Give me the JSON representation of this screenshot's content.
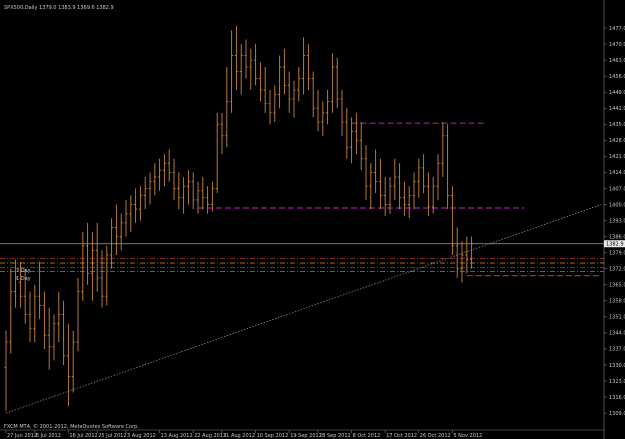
{
  "window": {
    "header": "SPX500,Daily  1379.0 1383.9 1369.6 1382.9",
    "watermark": "FXCM MT4, © 2001-2012, MetaQuotes Software Corp.",
    "current_price_tag": "1382.9",
    "level_labels": [
      "3 Day",
      "1 Day"
    ]
  },
  "colors": {
    "background": "#000000",
    "bars": "#c9863c",
    "resistance": "#a01aa0",
    "trendline": "#8b95c8",
    "price_line": "#a0a0a0",
    "pivot_a": "#c03030",
    "pivot_b": "#c8a800",
    "pivot_c": "#20a020",
    "pivot_d": "#30a0a0"
  },
  "chart_data": {
    "type": "ohlc",
    "symbol": "SPX500",
    "timeframe": "Daily",
    "ylim": [
      1306,
      1484
    ],
    "yticks": [
      1477.0,
      1470.0,
      1463.0,
      1456.0,
      1449.0,
      1442.0,
      1435.0,
      1428.0,
      1421.0,
      1414.0,
      1407.0,
      1400.0,
      1393.0,
      1386.0,
      1379.0,
      1372.0,
      1365.0,
      1358.0,
      1351.0,
      1344.0,
      1337.0,
      1330.0,
      1323.0,
      1316.0,
      1309.0
    ],
    "xticks": [
      "27 Jun 2012",
      "6 Jul 2012",
      "16 Jul 2012",
      "25 Jul 2012",
      "3 Aug 2012",
      "13 Aug 2012",
      "22 Aug 2012",
      "31 Aug 2012",
      "10 Sep 2012",
      "19 Sep 2012",
      "28 Sep 2012",
      "8 Oct 2012",
      "17 Oct 2012",
      "26 Oct 2012",
      "5 Nov 2012"
    ],
    "xtick_index": [
      0,
      6,
      13,
      19,
      25,
      32,
      39,
      45,
      52,
      59,
      65,
      72,
      79,
      86,
      93
    ],
    "last_price": 1382.9,
    "bars": [
      [
        1329,
        1345,
        1310,
        1340
      ],
      [
        1340,
        1372,
        1335,
        1362
      ],
      [
        1362,
        1376,
        1355,
        1368
      ],
      [
        1366,
        1375,
        1355,
        1360
      ],
      [
        1360,
        1372,
        1348,
        1352
      ],
      [
        1352,
        1362,
        1340,
        1346
      ],
      [
        1346,
        1365,
        1340,
        1360
      ],
      [
        1360,
        1375,
        1350,
        1356
      ],
      [
        1356,
        1362,
        1337,
        1343
      ],
      [
        1343,
        1355,
        1328,
        1338
      ],
      [
        1338,
        1352,
        1332,
        1348
      ],
      [
        1348,
        1362,
        1340,
        1352
      ],
      [
        1352,
        1358,
        1330,
        1334
      ],
      [
        1334,
        1348,
        1312,
        1325
      ],
      [
        1325,
        1345,
        1318,
        1340
      ],
      [
        1340,
        1368,
        1336,
        1362
      ],
      [
        1362,
        1388,
        1358,
        1382
      ],
      [
        1382,
        1392,
        1365,
        1370
      ],
      [
        1370,
        1388,
        1358,
        1380
      ],
      [
        1380,
        1392,
        1362,
        1368
      ],
      [
        1368,
        1380,
        1355,
        1360
      ],
      [
        1360,
        1382,
        1356,
        1378
      ],
      [
        1378,
        1394,
        1372,
        1390
      ],
      [
        1390,
        1400,
        1378,
        1386
      ],
      [
        1386,
        1396,
        1380,
        1392
      ],
      [
        1392,
        1402,
        1386,
        1396
      ],
      [
        1396,
        1404,
        1388,
        1400
      ],
      [
        1400,
        1407,
        1392,
        1398
      ],
      [
        1398,
        1408,
        1393,
        1404
      ],
      [
        1404,
        1412,
        1398,
        1407
      ],
      [
        1407,
        1414,
        1400,
        1410
      ],
      [
        1410,
        1418,
        1404,
        1412
      ],
      [
        1412,
        1420,
        1406,
        1415
      ],
      [
        1415,
        1422,
        1408,
        1418
      ],
      [
        1418,
        1424,
        1410,
        1414
      ],
      [
        1414,
        1420,
        1402,
        1407
      ],
      [
        1407,
        1414,
        1398,
        1403
      ],
      [
        1403,
        1412,
        1396,
        1408
      ],
      [
        1408,
        1415,
        1400,
        1410
      ],
      [
        1410,
        1414,
        1398,
        1402
      ],
      [
        1402,
        1410,
        1396,
        1406
      ],
      [
        1406,
        1412,
        1398,
        1403
      ],
      [
        1403,
        1408,
        1396,
        1400
      ],
      [
        1400,
        1410,
        1397,
        1407
      ],
      [
        1407,
        1440,
        1405,
        1435
      ],
      [
        1435,
        1440,
        1422,
        1430
      ],
      [
        1430,
        1460,
        1425,
        1445
      ],
      [
        1445,
        1476,
        1440,
        1465
      ],
      [
        1465,
        1478,
        1450,
        1458
      ],
      [
        1458,
        1470,
        1448,
        1465
      ],
      [
        1465,
        1472,
        1455,
        1460
      ],
      [
        1460,
        1468,
        1450,
        1463
      ],
      [
        1463,
        1470,
        1452,
        1455
      ],
      [
        1455,
        1462,
        1445,
        1450
      ],
      [
        1450,
        1460,
        1440,
        1444
      ],
      [
        1444,
        1450,
        1435,
        1440
      ],
      [
        1440,
        1452,
        1436,
        1448
      ],
      [
        1448,
        1465,
        1442,
        1460
      ],
      [
        1460,
        1468,
        1448,
        1452
      ],
      [
        1452,
        1458,
        1440,
        1446
      ],
      [
        1446,
        1454,
        1438,
        1450
      ],
      [
        1450,
        1460,
        1445,
        1455
      ],
      [
        1455,
        1473,
        1448,
        1465
      ],
      [
        1465,
        1470,
        1450,
        1455
      ],
      [
        1455,
        1458,
        1438,
        1442
      ],
      [
        1442,
        1450,
        1432,
        1436
      ],
      [
        1436,
        1445,
        1430,
        1440
      ],
      [
        1440,
        1450,
        1435,
        1445
      ],
      [
        1445,
        1466,
        1440,
        1460
      ],
      [
        1460,
        1464,
        1442,
        1446
      ],
      [
        1446,
        1450,
        1430,
        1436
      ],
      [
        1436,
        1442,
        1420,
        1425
      ],
      [
        1425,
        1438,
        1418,
        1432
      ],
      [
        1432,
        1440,
        1422,
        1428
      ],
      [
        1428,
        1436,
        1415,
        1420
      ],
      [
        1420,
        1426,
        1402,
        1408
      ],
      [
        1408,
        1418,
        1398,
        1414
      ],
      [
        1414,
        1424,
        1405,
        1410
      ],
      [
        1410,
        1420,
        1398,
        1404
      ],
      [
        1404,
        1412,
        1395,
        1400
      ],
      [
        1400,
        1412,
        1396,
        1408
      ],
      [
        1408,
        1420,
        1402,
        1412
      ],
      [
        1412,
        1418,
        1398,
        1403
      ],
      [
        1403,
        1410,
        1395,
        1400
      ],
      [
        1400,
        1408,
        1394,
        1404
      ],
      [
        1404,
        1414,
        1398,
        1410
      ],
      [
        1410,
        1420,
        1403,
        1416
      ],
      [
        1416,
        1422,
        1405,
        1408
      ],
      [
        1408,
        1414,
        1395,
        1399
      ],
      [
        1399,
        1412,
        1396,
        1408
      ],
      [
        1408,
        1422,
        1402,
        1418
      ],
      [
        1418,
        1436,
        1412,
        1430
      ],
      [
        1430,
        1435,
        1398,
        1404
      ],
      [
        1404,
        1408,
        1378,
        1382
      ],
      [
        1382,
        1390,
        1368,
        1372
      ],
      [
        1372,
        1384,
        1366,
        1378
      ],
      [
        1378,
        1386,
        1370,
        1376
      ],
      [
        1376,
        1386,
        1372,
        1382.9
      ]
    ],
    "price_line": 1382.9,
    "resistance_lines": [
      {
        "from_index": 72,
        "to_index": 100,
        "value": 1435.5
      },
      {
        "from_index": 40,
        "to_index": 108,
        "value": 1398.5
      },
      {
        "from_index": 96,
        "to_index": 124,
        "value": 1369.0
      }
    ],
    "trendline": {
      "from_index": 0,
      "from_value": 1309.0,
      "to_index": 124,
      "to_value": 1400.0
    },
    "pivot_levels": [
      {
        "value": 1376.5,
        "color": "#c03030",
        "style": "dashdot"
      },
      {
        "value": 1374.5,
        "color": "#c8a800",
        "style": "dashdot"
      },
      {
        "value": 1372.5,
        "color": "#20a020",
        "style": "dashdot"
      },
      {
        "value": 1370.8,
        "color": "#30a0a0",
        "style": "dashdot"
      }
    ]
  }
}
